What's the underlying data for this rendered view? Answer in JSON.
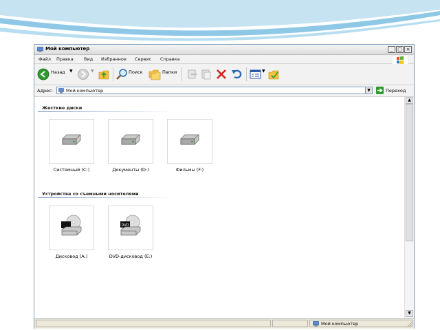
{
  "window": {
    "title": "Мой компьютер",
    "controls": {
      "minimize": "_",
      "maximize": "□",
      "close": "×"
    }
  },
  "menu": [
    "Файл",
    "Правка",
    "Вид",
    "Избранное",
    "Сервис",
    "Справка"
  ],
  "toolbar": {
    "back_label": "Назад",
    "search_label": "Поиск",
    "folders_label": "Папки"
  },
  "address": {
    "label": "Адрес:",
    "value": "Мой компьютер",
    "go_label": "Переход"
  },
  "sections": {
    "hard_drives": {
      "title": "Жесткие диски",
      "items": [
        {
          "label": "Системный (C:)",
          "icon": "hard-drive-icon"
        },
        {
          "label": "Документы (D:)",
          "icon": "hard-drive-icon"
        },
        {
          "label": "Фильмы (F:)",
          "icon": "hard-drive-icon"
        }
      ]
    },
    "removable": {
      "title": "Устройства со съемными носителями",
      "items": [
        {
          "label": "Дисковод (A:)",
          "icon": "floppy-drive-icon"
        },
        {
          "label": "DVD-дисковод (E:)",
          "icon": "dvd-drive-icon",
          "badge": "DVD"
        }
      ]
    }
  },
  "status": {
    "text": "Мой компьютер"
  },
  "colors": {
    "accent": "#7a96c8",
    "back": "#2e9a2e",
    "delete": "#d4201c",
    "folder": "#f2c23c"
  }
}
